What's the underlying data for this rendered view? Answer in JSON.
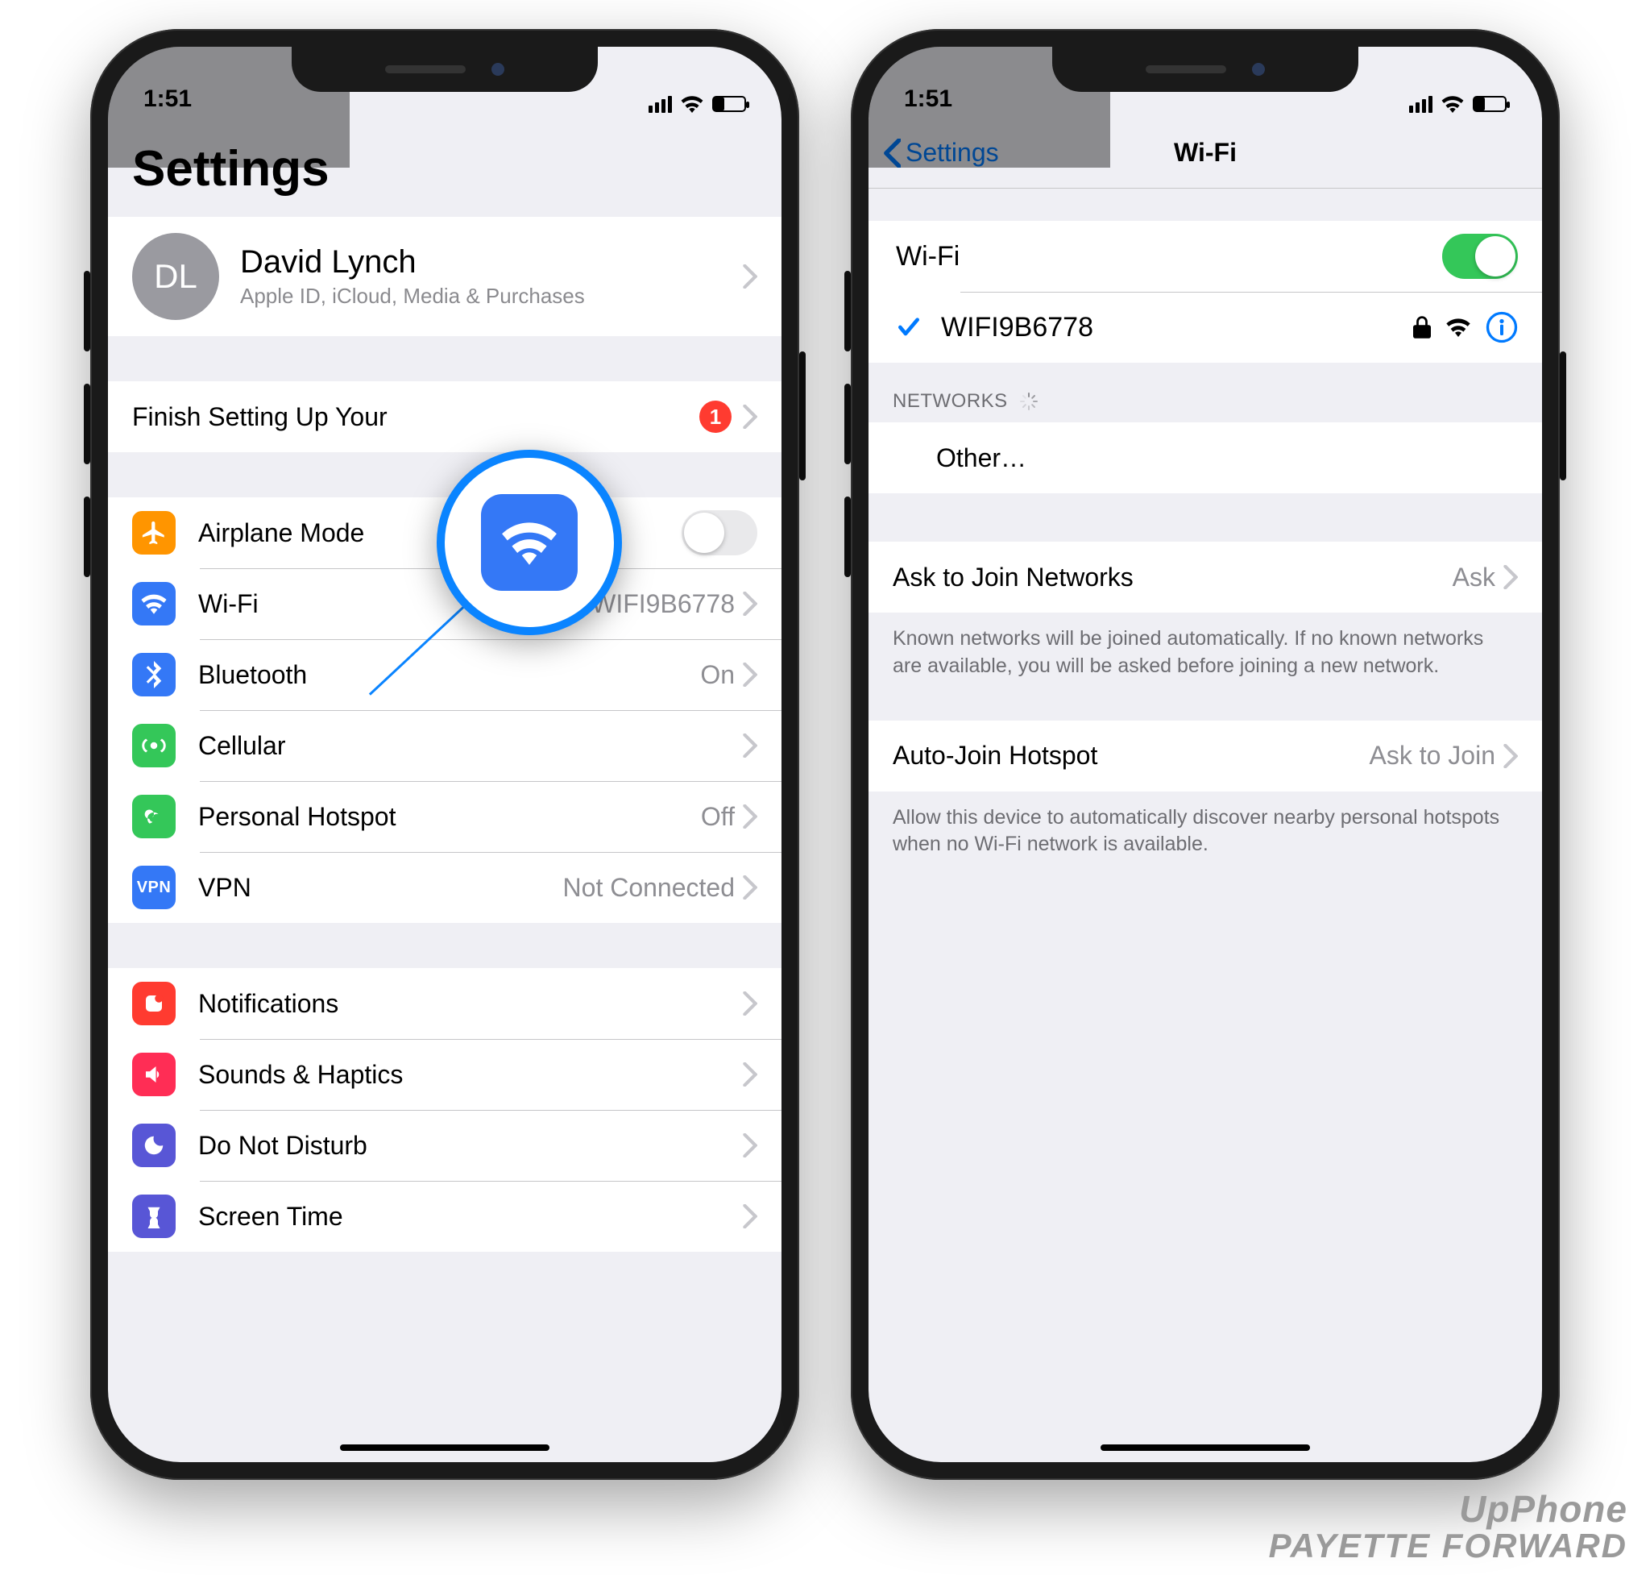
{
  "statusbar": {
    "time": "1:51"
  },
  "left": {
    "title": "Settings",
    "appleid": {
      "initials": "DL",
      "name": "David Lynch",
      "sub": "Apple ID, iCloud, Media & Purchases"
    },
    "finish": {
      "label": "Finish Setting Up Your",
      "badge": "1"
    },
    "rows": {
      "airplane": {
        "label": "Airplane Mode"
      },
      "wifi": {
        "label": "Wi-Fi",
        "value": "WIFI9B6778"
      },
      "bluetooth": {
        "label": "Bluetooth",
        "value": "On"
      },
      "cellular": {
        "label": "Cellular"
      },
      "hotspot": {
        "label": "Personal Hotspot",
        "value": "Off"
      },
      "vpn": {
        "label": "VPN",
        "value": "Not Connected"
      },
      "notifications": {
        "label": "Notifications"
      },
      "sounds": {
        "label": "Sounds & Haptics"
      },
      "dnd": {
        "label": "Do Not Disturb"
      },
      "screentime": {
        "label": "Screen Time"
      }
    }
  },
  "right": {
    "back": "Settings",
    "title": "Wi-Fi",
    "toggleRow": {
      "label": "Wi-Fi"
    },
    "connected": {
      "ssid": "WIFI9B6778"
    },
    "networksHeader": "NETWORKS",
    "other": "Other…",
    "askJoin": {
      "label": "Ask to Join Networks",
      "value": "Ask"
    },
    "askJoinFooter": "Known networks will be joined automatically. If no known networks are available, you will be asked before joining a new network.",
    "autoHotspot": {
      "label": "Auto-Join Hotspot",
      "value": "Ask to Join"
    },
    "autoHotspotFooter": "Allow this device to automatically discover nearby personal hotspots when no Wi-Fi network is available."
  },
  "watermark": {
    "l1": "UpPhone",
    "l2": "PAYETTE FORWARD"
  },
  "colors": {
    "accent": "#007aff",
    "wifiIconBg": "#3478f6",
    "green": "#34c759",
    "orange": "#ff9500",
    "red": "#ff3b30",
    "purple": "#5856d6",
    "darkgreen": "#34c759"
  }
}
